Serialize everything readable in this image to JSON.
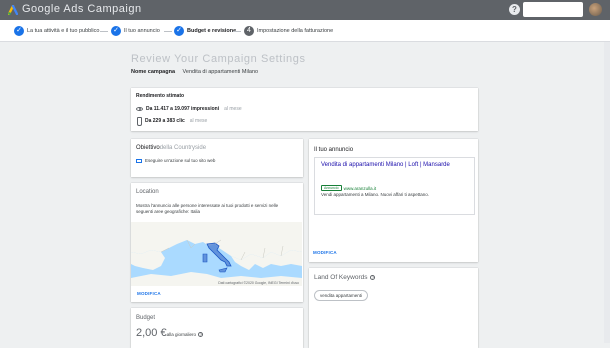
{
  "app": {
    "title": "Google Ads Campaign"
  },
  "stepper": {
    "steps": [
      {
        "label": "La tua attività e il tuo pubblico",
        "state": "done"
      },
      {
        "label": "Il tuo annuncio",
        "state": "done"
      },
      {
        "label": "Budget e revisione",
        "state": "current"
      },
      {
        "label": "Impostazione della fatturazione",
        "state": "todo",
        "number": "4"
      }
    ]
  },
  "review": {
    "title": "Review Your Campaign Settings",
    "campaign_name_label": "Nome campagna",
    "campaign_name_value": "Vendita di appartamenti Milano"
  },
  "performance": {
    "title": "Rendimento stimato",
    "impressions_value": "Da 11.417 a 19.097 impressioni",
    "impressions_unit": "al mese",
    "clicks_value": "Da 229 a 383 clic",
    "clicks_unit": "al mese"
  },
  "objective": {
    "title": "Obiettivo",
    "title_faint": "della Countryside",
    "action_label": "Eseguire un'azione sul tuo sito web"
  },
  "location": {
    "title": "Location",
    "description": "Mostra l'annuncio alle persone interessate ai tuoi prodotti e servizi nelle seguenti aree geografiche: Italia",
    "map_credit": "Dati cartografici ©2020 Google, INEGI   Termini d'uso",
    "modify": "MODIFICA"
  },
  "budget": {
    "title": "Budget",
    "value": "2,00 €",
    "unit": "...alla giornaliero",
    "info": "?"
  },
  "ad": {
    "title": "Il tuo annuncio",
    "headline": "Vendita di appartamenti Milano | Loft | Mansarde",
    "badge": "Annuncio",
    "url": "www.aranzulla.it",
    "description": "Vendi appartamenti a Milano. Nuovi affari ti aspettano.",
    "modify": "MODIFICA"
  },
  "keywords": {
    "title": "Land Of Keywords",
    "info": "?",
    "chips": [
      "vendita appartamenti"
    ]
  },
  "colors": {
    "topbar": "#5f6368",
    "accent": "#1a73e8",
    "background": "#eef0f1",
    "map_water": "#aadaff",
    "map_land": "#f5f5f0",
    "italy_highlight": "#4a7bd0"
  }
}
